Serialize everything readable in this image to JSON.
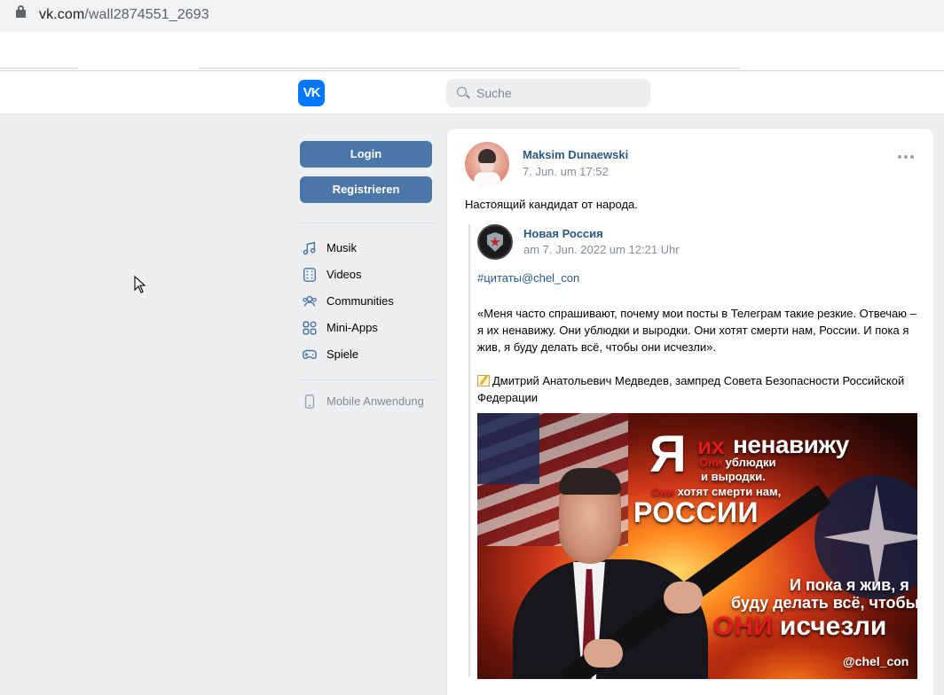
{
  "browser": {
    "url_host": "vk.com",
    "url_path": "/wall2874551_2693"
  },
  "vk": {
    "search_placeholder": "Suche",
    "logo_text": "VK"
  },
  "nav": {
    "login": "Login",
    "register": "Registrieren",
    "items": [
      {
        "label": "Musik",
        "icon": "music-icon"
      },
      {
        "label": "Videos",
        "icon": "video-icon"
      },
      {
        "label": "Communities",
        "icon": "communities-icon"
      },
      {
        "label": "Mini-Apps",
        "icon": "mini-apps-icon"
      },
      {
        "label": "Spiele",
        "icon": "gamepad-icon"
      }
    ],
    "mobile": "Mobile Anwendung"
  },
  "post": {
    "author": "Maksim Dunaewski",
    "date": "7. Jun. um 17:52",
    "text": "Настоящий кандидат от народа.",
    "repost": {
      "author": "Новая Россия",
      "date": "am 7. Jun. 2022 um 12:21 Uhr",
      "hashtag": "#цитаты@chel_con",
      "quote": "«Меня часто спрашивают, почему мои посты в Телеграм такие резкие. Отвечаю – я их ненавижу. Они ублюдки и выродки. Они хотят смерти нам, России. И пока я жив, я буду делать всё, чтобы они исчезли».",
      "attribution": "Дмитрий Анатольевич Медведев, зампред Совета Безопасности Российской Федерации",
      "poster": {
        "ya": "Я",
        "ikh": "их",
        "nenavizhu": "ненавижу",
        "oni1": "Они",
        "l1_rest": "ублюдки",
        "l2": "и выродки.",
        "oni2": "Они",
        "l3_rest": "хотят смерти нам,",
        "rossii": "РОССИИ",
        "b1": "И пока я жив, я",
        "b2": "буду делать всё, чтобы",
        "b3_red": "ОНИ",
        "b3_rest": "исчезли",
        "tag": "@chel_con"
      }
    }
  }
}
